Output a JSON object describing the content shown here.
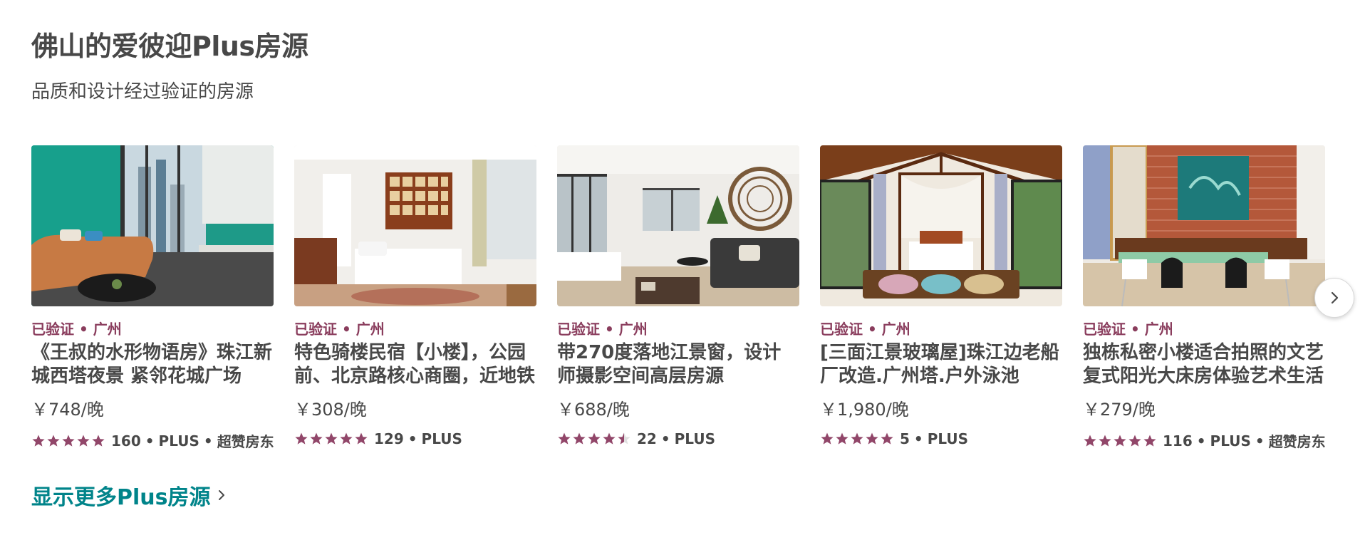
{
  "section": {
    "title": "佛山的爱彼迎Plus房源",
    "subtitle": "品质和设计经过验证的房源",
    "show_more": "显示更多Plus房源"
  },
  "colors": {
    "accent_meta": "#8a3d5d",
    "star": "#914669",
    "link": "#00848a",
    "text": "#484848"
  },
  "icons": {
    "next": "chevron-right-icon",
    "more": "chevron-right-icon",
    "star": "star-icon"
  },
  "listings": [
    {
      "meta": "已验证 • 广州",
      "name": "《王叔的水形物语房》珠江新城西塔夜景 紧邻花城广场",
      "price": "￥748/晚",
      "stars": 5,
      "reviews": "160",
      "badge": "PLUS",
      "superhost": "超赞房东"
    },
    {
      "meta": "已验证 • 广州",
      "name": "特色骑楼民宿【小楼】，公园前、北京路核心商圈，近地铁",
      "price": "￥308/晚",
      "stars": 5,
      "reviews": "129",
      "badge": "PLUS",
      "superhost": ""
    },
    {
      "meta": "已验证 • 广州",
      "name": "带270度落地江景窗，设计师摄影空间高层房源",
      "price": "￥688/晚",
      "stars": 4.5,
      "reviews": "22",
      "badge": "PLUS",
      "superhost": ""
    },
    {
      "meta": "已验证 • 广州",
      "name": "[三面江景玻璃屋]珠江边老船厂改造.广州塔.户外泳池",
      "price": "￥1,980/晚",
      "stars": 5,
      "reviews": "5",
      "badge": "PLUS",
      "superhost": ""
    },
    {
      "meta": "已验证 • 广州",
      "name": "独栋私密小楼适合拍照的文艺复式阳光大床房体验艺术生活",
      "price": "￥279/晚",
      "stars": 5,
      "reviews": "116",
      "badge": "PLUS",
      "superhost": "超赞房东"
    }
  ]
}
